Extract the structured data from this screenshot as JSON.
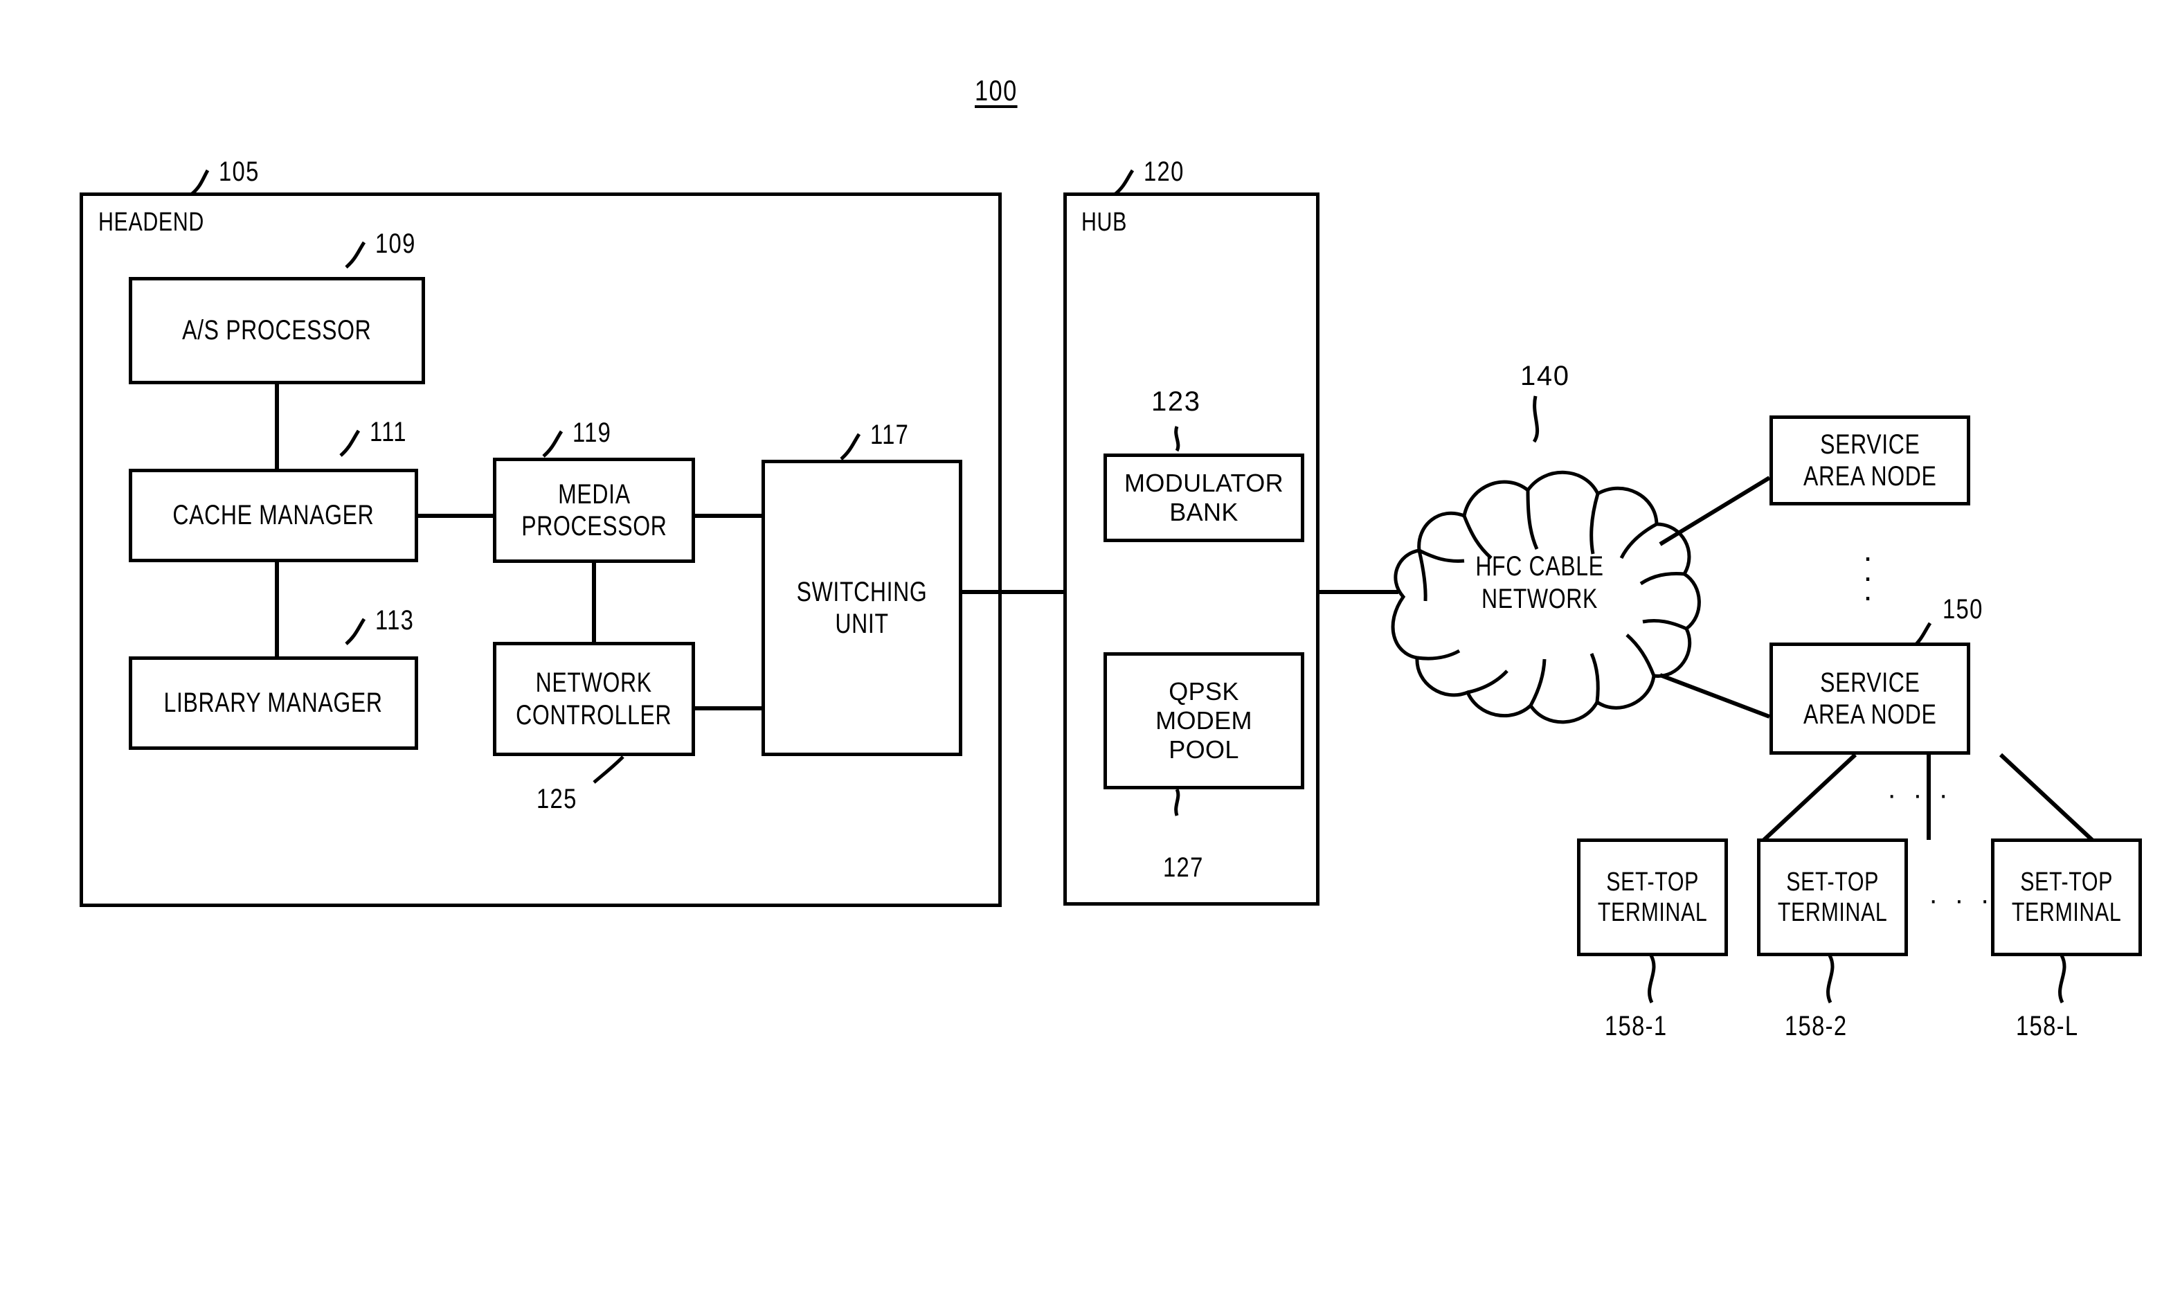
{
  "figure": {
    "number": "100",
    "type": "block-diagram"
  },
  "headend": {
    "title": "HEADEND",
    "ref": "105",
    "blocks": [
      {
        "label": "A/S PROCESSOR",
        "ref": "109"
      },
      {
        "label": "CACHE MANAGER",
        "ref": "111"
      },
      {
        "label": "LIBRARY MANAGER",
        "ref": "113"
      },
      {
        "label": "MEDIA\nPROCESSOR",
        "ref": "119"
      },
      {
        "label": "NETWORK\nCONTROLLER",
        "ref": "125"
      },
      {
        "label": "SWITCHING\nUNIT",
        "ref": "117"
      }
    ]
  },
  "hub": {
    "title": "HUB",
    "ref": "120",
    "blocks": [
      {
        "label": "MODULATOR\nBANK",
        "ref": "123"
      },
      {
        "label": "QPSK\nMODEM\nPOOL",
        "ref": "127"
      }
    ]
  },
  "network": {
    "label": "HFC CABLE\nNETWORK",
    "ref": "140",
    "shape": "cloud-icon"
  },
  "service_area_nodes": {
    "label": "SERVICE\nAREA NODE",
    "ref": "150",
    "vertical_ellipsis": "·\n·\n·"
  },
  "set_top_terminals": {
    "label": "SET-TOP\nTERMINAL",
    "refs": [
      "158-1",
      "158-2",
      "158-L"
    ],
    "ellipsis_between_nodes": "· · ·",
    "ellipsis_between_boxes": "· · ·"
  },
  "colors": {
    "ink": "#000000",
    "paper": "#ffffff"
  }
}
